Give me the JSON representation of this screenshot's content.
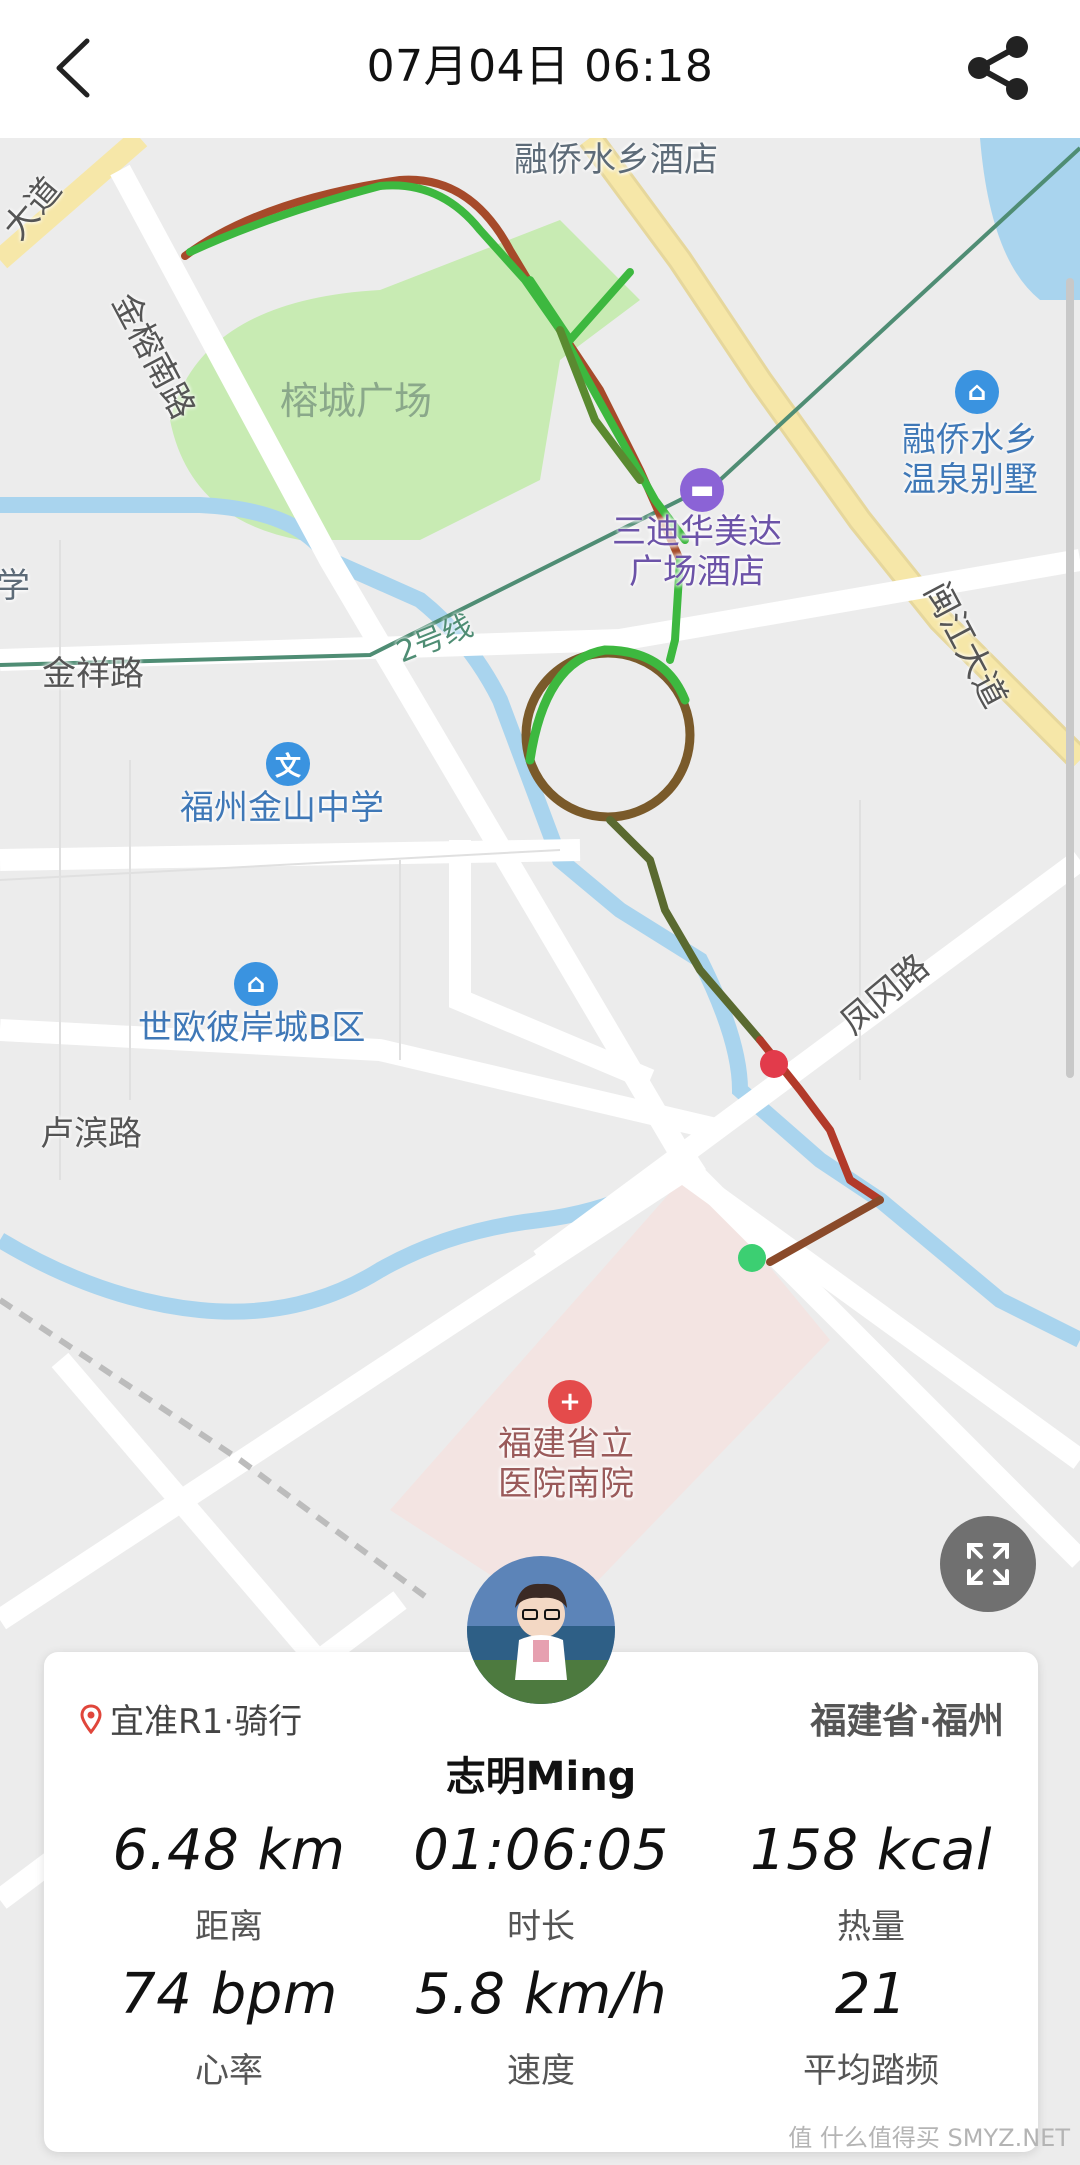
{
  "header": {
    "title": "07月04日 06:18",
    "back_icon": "chevron-left-icon",
    "share_icon": "share-icon"
  },
  "map": {
    "labels": {
      "hotel_top": "融侨水乡酒店",
      "park": "榕城广场",
      "jinrong_road": "金榕南路",
      "road_left_top": "大道",
      "villa_line1": "融侨水乡",
      "villa_line2": "温泉别墅",
      "hotel_mid_line1": "三迪华美达",
      "hotel_mid_line2": "广场酒店",
      "xue": "学",
      "jinxiang_road": "金祥路",
      "metro_line": "2号线",
      "minjiang_road": "闽江大道",
      "school": "福州金山中学",
      "estate": "世欧彼岸城B区",
      "fenggang_road": "凤冈路",
      "lubin_road": "卢滨路",
      "hospital_line1": "福建省立",
      "hospital_line2": "医院南院"
    },
    "colors": {
      "route_green": "#3db83f",
      "route_red": "#b23a2a",
      "water": "#a9d4ee",
      "park": "#c8ebb3",
      "road_major": "#f6e7a8",
      "hospital_zone": "#f3e4e2",
      "poi_blue": "#3a93e0",
      "poi_purple": "#8b63d6",
      "poi_red": "#e44b4b",
      "end_marker": "#e23b4b",
      "start_marker": "#3ccf72"
    },
    "fullscreen_icon": "fullscreen-icon"
  },
  "card": {
    "device": "宜准R1·骑行",
    "location": "福建省·福州",
    "username": "志明Ming",
    "stats": [
      {
        "value": "6.48 km",
        "label": "距离"
      },
      {
        "value": "01:06:05",
        "label": "时长"
      },
      {
        "value": "158 kcal",
        "label": "热量"
      },
      {
        "value": "74 bpm",
        "label": "心率"
      },
      {
        "value": "5.8 km/h",
        "label": "速度"
      },
      {
        "value": "21",
        "label": "平均踏频"
      }
    ]
  },
  "watermark": "值 什么值得买 SMYZ.NET"
}
